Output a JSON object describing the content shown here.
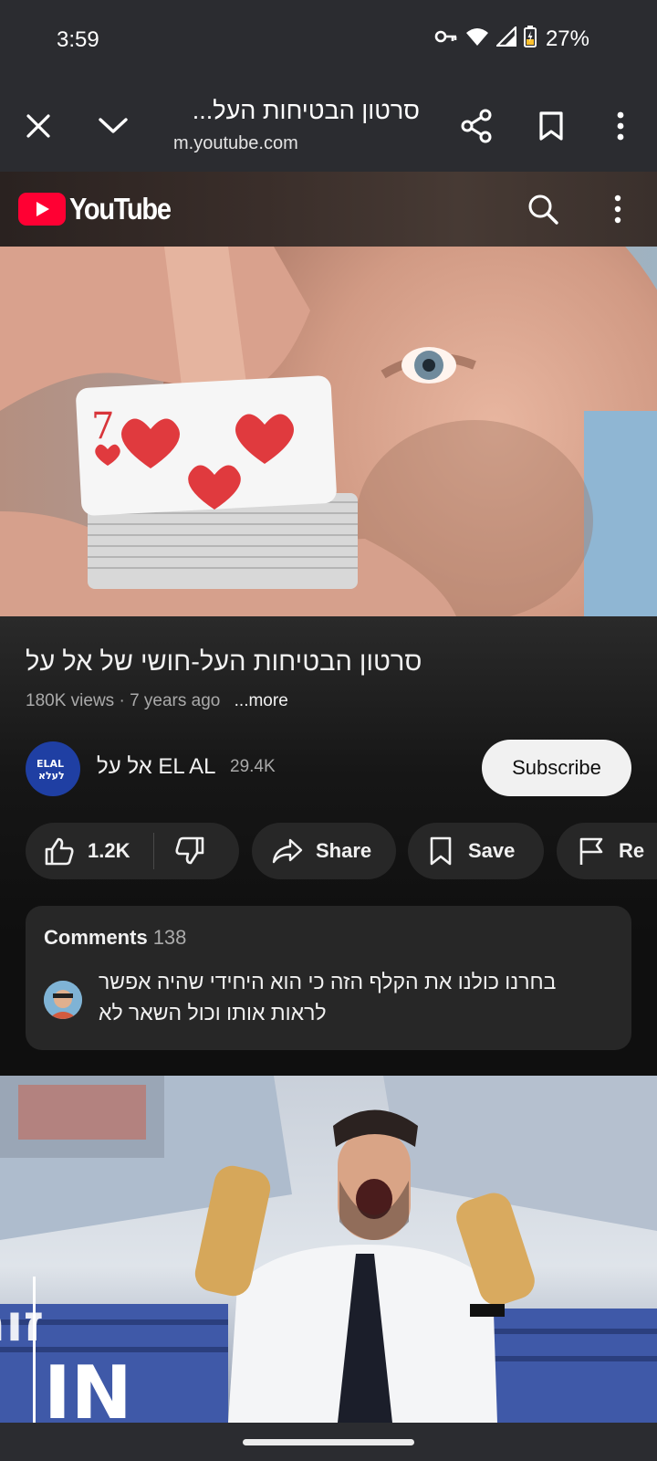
{
  "status_bar": {
    "time": "3:59",
    "battery": "27%",
    "icons": [
      "vpn-key-icon",
      "wifi-icon",
      "cell-signal-icon",
      "battery-charging-icon"
    ]
  },
  "tab_bar": {
    "title": "סרטון הבטיחות העל...",
    "url": "m.youtube.com",
    "icons": [
      "close-icon",
      "chevron-down-icon",
      "share-icon",
      "bookmark-icon",
      "more-vert-icon"
    ]
  },
  "youtube_header": {
    "logo_text": "YouTube",
    "icons": [
      "search-icon",
      "more-vert-icon"
    ],
    "brand_color": "#ff0033"
  },
  "video": {
    "title": "סרטון הבטיחות העל-חושי של אל על",
    "views": "180K views",
    "age": "7 years ago",
    "separator": " · ",
    "more_label": "...more"
  },
  "channel": {
    "name": "אל על EL AL",
    "subscribers": "29.4K",
    "subscribe_label": "Subscribe"
  },
  "actions": {
    "likes": "1.2K",
    "share_label": "Share",
    "save_label": "Save",
    "report_label": "Re"
  },
  "comments": {
    "header": "Comments",
    "count": "138",
    "top_comment": "בחרנו כולנו את הקלף הזה כי הוא היחידי שהיה אפשר לראות אותו וכול השאר לא"
  },
  "next_video": {
    "overlay_text": "זום IN"
  }
}
